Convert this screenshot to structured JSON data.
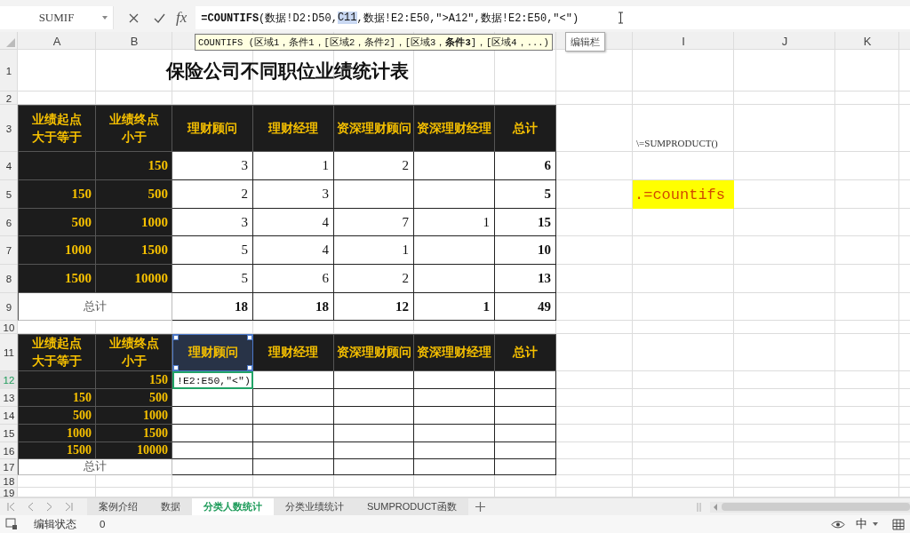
{
  "formula_bar": {
    "name_box": "SUMIF",
    "fx_label": "fx",
    "formula": [
      {
        "text": "**=COUNTIFS**(数据!D2:D50,",
        "highlighted": false
      },
      {
        "text": "C11",
        "highlighted": true
      },
      {
        "text": ",数据!E2:E50,\">A12\",数据!E2:E50,\"<\")",
        "highlighted": false
      }
    ]
  },
  "tooltips": [
    {
      "kind": "signature",
      "text": "COUNTIFS (区域1，条件1，[区域2，条件2]，[区域3，**条件3**]，[区域4，...)"
    },
    {
      "kind": "hint",
      "text": "编辑栏"
    }
  ],
  "column_headers": [
    {
      "label": "A"
    },
    {
      "label": "B"
    },
    {
      "label": "I"
    },
    {
      "label": "J"
    },
    {
      "label": "K"
    }
  ],
  "row_numbers": [
    {
      "label": "1",
      "selected": false
    },
    {
      "label": "2",
      "selected": false
    },
    {
      "label": "3",
      "selected": false
    },
    {
      "label": "4",
      "selected": false
    },
    {
      "label": "5",
      "selected": false
    },
    {
      "label": "6",
      "selected": false
    },
    {
      "label": "7",
      "selected": false
    },
    {
      "label": "8",
      "selected": false
    },
    {
      "label": "9",
      "selected": false
    },
    {
      "label": "10",
      "selected": false
    },
    {
      "label": "11",
      "selected": false
    },
    {
      "label": "12",
      "selected": true
    },
    {
      "label": "13",
      "selected": false
    },
    {
      "label": "14",
      "selected": false
    },
    {
      "label": "15",
      "selected": false
    },
    {
      "label": "16",
      "selected": false
    },
    {
      "label": "17",
      "selected": false
    },
    {
      "label": "18",
      "selected": false
    },
    {
      "label": "19",
      "selected": false
    }
  ],
  "title": "保险公司不同职位业绩统计表",
  "table_1": {
    "headers": [
      {
        "lines": [
          "业绩起点",
          "大于等于"
        ]
      },
      {
        "lines": [
          "业绩终点",
          "小于"
        ]
      },
      {
        "lines": [
          "理财顾问"
        ]
      },
      {
        "lines": [
          "理财经理"
        ]
      },
      {
        "lines": [
          "资深理财顾问"
        ]
      },
      {
        "lines": [
          "资深理财经理"
        ]
      },
      {
        "lines": [
          "总计"
        ]
      }
    ],
    "rows": [
      {
        "cells": [
          null,
          "150",
          "3",
          "1",
          "2",
          null,
          "6"
        ]
      },
      {
        "cells": [
          "150",
          "500",
          "2",
          "3",
          null,
          null,
          "5"
        ]
      },
      {
        "cells": [
          "500",
          "1000",
          "3",
          "4",
          "7",
          "1",
          "15"
        ]
      },
      {
        "cells": [
          "1000",
          "1500",
          "5",
          "4",
          "1",
          null,
          "10"
        ]
      },
      {
        "cells": [
          "1500",
          "10000",
          "5",
          "6",
          "2",
          null,
          "13"
        ]
      }
    ],
    "total": {
      "label": "总计",
      "cells": [
        "18",
        "18",
        "12",
        "1",
        "49"
      ]
    }
  },
  "table_2": {
    "headers": [
      {
        "lines": [
          "业绩起点",
          "大于等于"
        ],
        "selected": false
      },
      {
        "lines": [
          "业绩终点",
          "小于"
        ],
        "selected": false
      },
      {
        "lines": [
          "理财顾问"
        ],
        "selected": true
      },
      {
        "lines": [
          "理财经理"
        ],
        "selected": false
      },
      {
        "lines": [
          "资深理财顾问"
        ],
        "selected": false
      },
      {
        "lines": [
          "资深理财经理"
        ],
        "selected": false
      },
      {
        "lines": [
          "总计"
        ],
        "selected": false
      }
    ],
    "rows": [
      {
        "cells": [
          null,
          "150"
        ],
        "editing_text": "!E2:E50,\"<\")"
      },
      {
        "cells": [
          "150",
          "500"
        ]
      },
      {
        "cells": [
          "500",
          "1000"
        ]
      },
      {
        "cells": [
          "1000",
          "1500"
        ]
      },
      {
        "cells": [
          "1500",
          "10000"
        ]
      }
    ],
    "total": {
      "label": "总计"
    }
  },
  "notes": [
    {
      "kind": "plain",
      "text": "\\=SUMPRODUCT()"
    },
    {
      "kind": "highlight",
      "text": ".=countifs"
    }
  ],
  "sheet_tabs": [
    {
      "label": "案例介绍",
      "selected": false
    },
    {
      "label": "数据",
      "selected": false
    },
    {
      "label": "分类人数统计",
      "selected": true
    },
    {
      "label": "分类业绩统计",
      "selected": false
    },
    {
      "label": "SUMPRODUCT函数",
      "selected": false
    }
  ],
  "status_bar": {
    "mode": "编辑状态",
    "count": "0",
    "ime": "中"
  }
}
